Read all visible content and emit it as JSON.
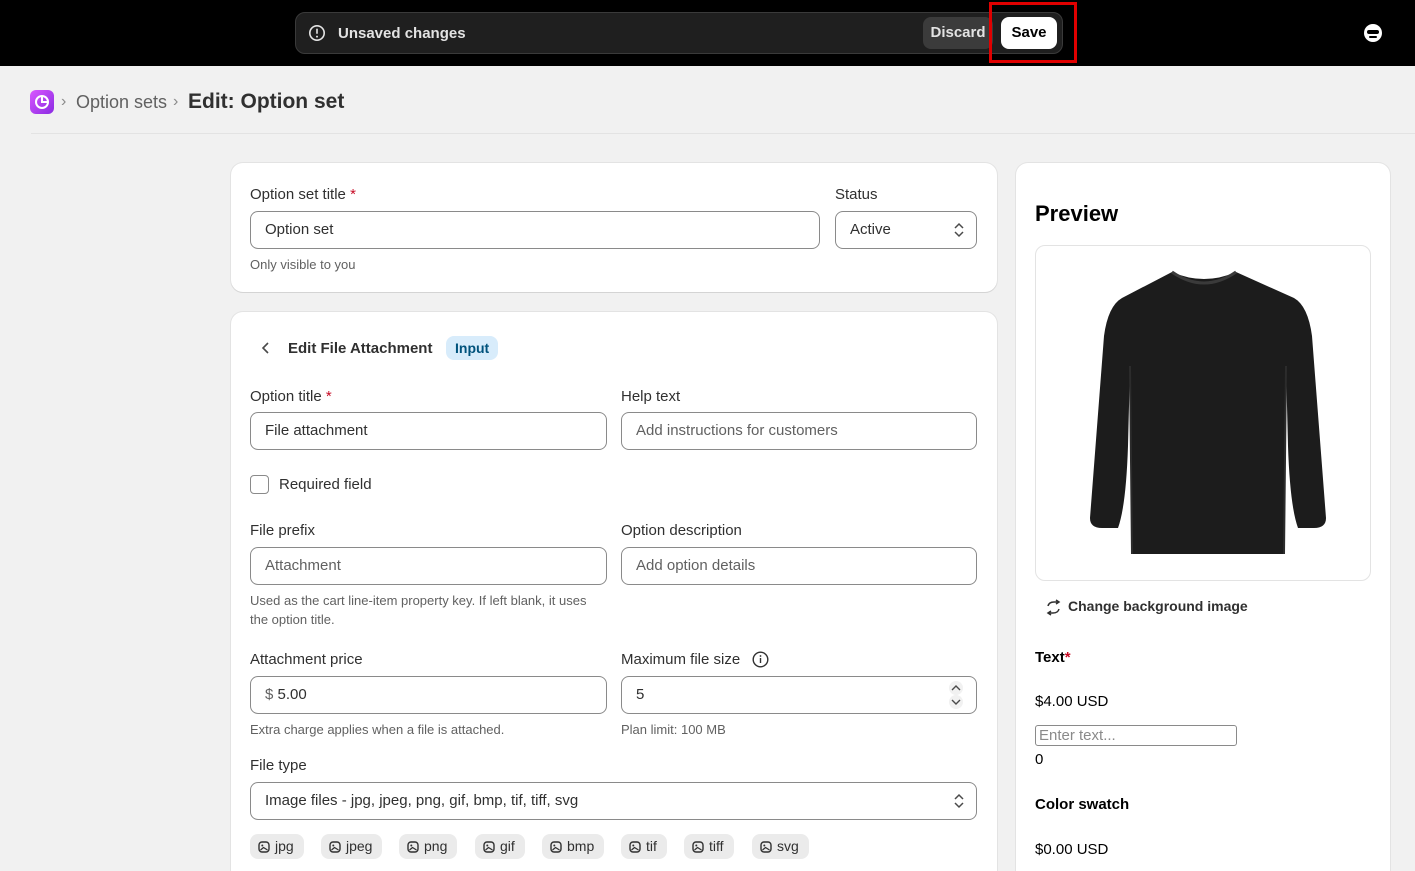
{
  "topbar": {
    "unsaved_label": "Unsaved changes",
    "discard_label": "Discard",
    "save_label": "Save"
  },
  "breadcrumb": {
    "parent": "Option sets",
    "title": "Edit: Option set"
  },
  "option_set": {
    "title_label": "Option set title",
    "title_value": "Option set",
    "title_hint": "Only visible to you",
    "status_label": "Status",
    "status_value": "Active"
  },
  "edit_option": {
    "heading": "Edit File Attachment",
    "badge": "Input",
    "option_title_label": "Option title",
    "option_title_value": "File attachment",
    "help_text_label": "Help text",
    "help_text_placeholder": "Add instructions for customers",
    "required_label": "Required field",
    "file_prefix_label": "File prefix",
    "file_prefix_placeholder": "Attachment",
    "file_prefix_hint": "Used as the cart line-item property key. If left blank, it uses the option title.",
    "option_description_label": "Option description",
    "option_description_placeholder": "Add option details",
    "attachment_price_label": "Attachment price",
    "currency_symbol": "$",
    "attachment_price_value": "5.00",
    "attachment_price_hint": "Extra charge applies when a file is attached.",
    "max_file_size_label": "Maximum file size",
    "max_file_size_value": "5",
    "max_file_size_hint": "Plan limit: 100 MB",
    "file_type_label": "File type",
    "file_type_value": "Image files - jpg, jpeg, png, gif, bmp, tif, tiff, svg",
    "file_tags": [
      "jpg",
      "jpeg",
      "png",
      "gif",
      "bmp",
      "tif",
      "tiff",
      "svg"
    ]
  },
  "preview": {
    "title": "Preview",
    "change_bg_label": "Change background image",
    "text_label": "Text",
    "text_price": "$4.00 USD",
    "text_placeholder": "Enter text...",
    "text_count": "0",
    "color_swatch_label": "Color swatch",
    "color_swatch_price": "$0.00 USD"
  },
  "colors": {
    "topbar_bg": "#000000",
    "highlight": "#e00000",
    "badge_bg": "#d8ecfb",
    "required": "#c70a24"
  }
}
